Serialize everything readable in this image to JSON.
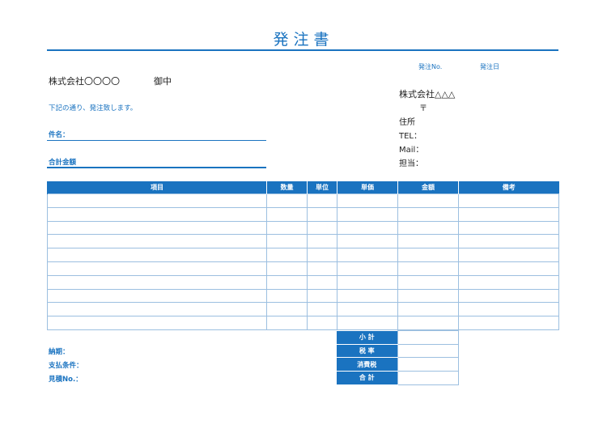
{
  "doc": {
    "title": "発注書",
    "order_no_label": "発注No.",
    "order_date_label": "発注日",
    "recipient": "株式会社〇〇〇〇",
    "honorific": "御中",
    "note": "下記の通り、発注致します。",
    "subject_label": "件名：",
    "total_amount_label": "合計金額"
  },
  "sender": {
    "company": "株式会社△△△",
    "postal": "〒",
    "address_label": "住所",
    "tel_label": "TEL：",
    "mail_label": "Mail：",
    "person_label": "担当："
  },
  "table": {
    "headers": [
      "項目",
      "数量",
      "単位",
      "単価",
      "金額",
      "備考"
    ],
    "row_count": 10
  },
  "totals": {
    "labels": [
      "小 計",
      "税 率",
      "消費税",
      "合 計"
    ]
  },
  "footer": {
    "delivery_label": "納期：",
    "payment_label": "支払条件：",
    "estimate_label": "見積No.："
  },
  "colors": {
    "accent": "#1a73c0",
    "grid": "#9cbfe0"
  }
}
